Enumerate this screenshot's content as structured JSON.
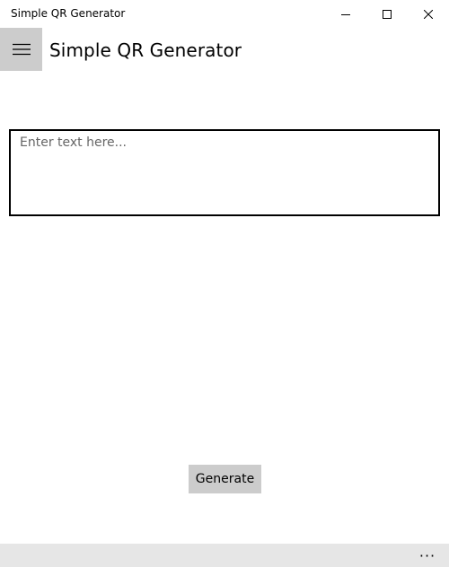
{
  "window": {
    "title": "Simple QR Generator",
    "controls": [
      "minimize-icon",
      "maximize-icon",
      "close-icon"
    ]
  },
  "header": {
    "menu_icon": "hamburger-icon",
    "title": "Simple QR Generator"
  },
  "input": {
    "value": "",
    "placeholder": "Enter text here..."
  },
  "actions": {
    "generate_label": "Generate"
  },
  "appbar": {
    "more_label": "···"
  },
  "colors": {
    "accent_gray": "#cccccc",
    "appbar_bg": "#e6e6e6",
    "border": "#000000",
    "background": "#ffffff"
  }
}
